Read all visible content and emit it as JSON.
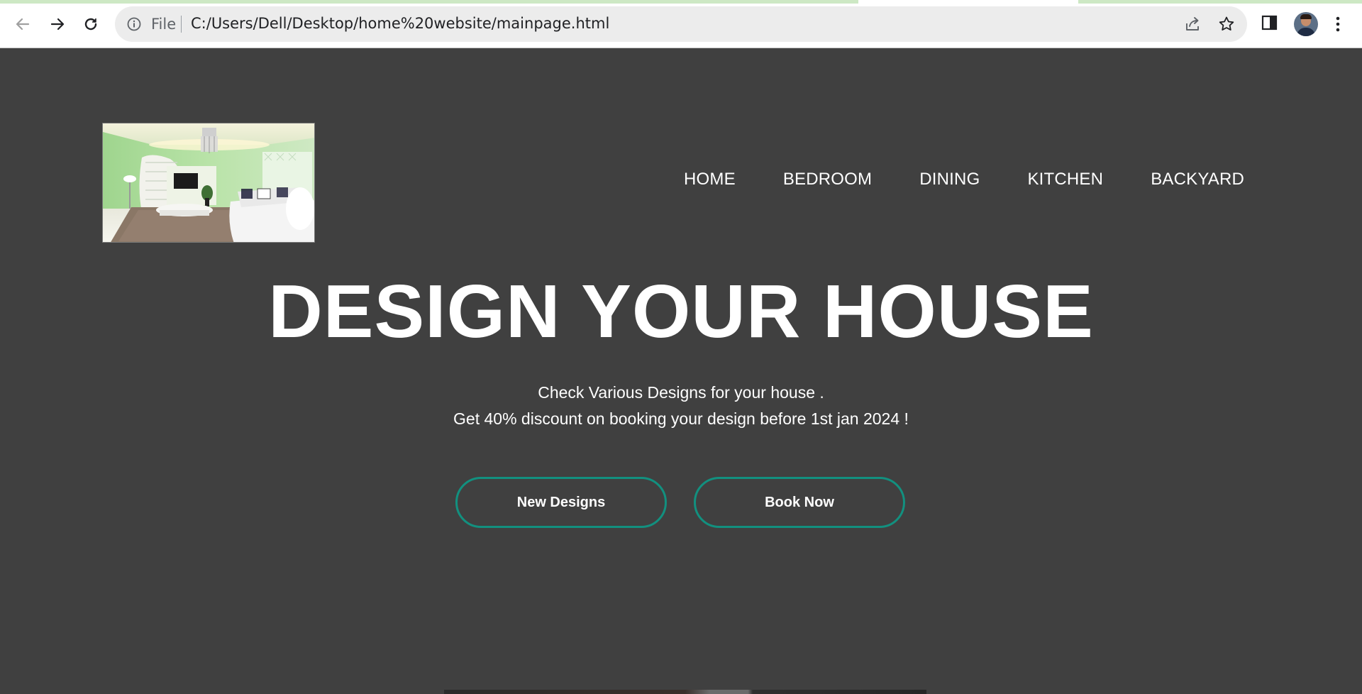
{
  "browser": {
    "scheme_label": "File",
    "url": "C:/Users/Dell/Desktop/home%20website/mainpage.html"
  },
  "site": {
    "nav": [
      {
        "label": "HOME"
      },
      {
        "label": "BEDROOM"
      },
      {
        "label": "DINING"
      },
      {
        "label": "KITCHEN"
      },
      {
        "label": "BACKYARD"
      }
    ],
    "hero": {
      "title": "DESIGN YOUR HOUSE",
      "line1": "Check Various Designs for your house .",
      "line2": "Get 40% discount on booking your design before 1st jan 2024 !"
    },
    "buttons": {
      "new_designs": "New Designs",
      "book_now": "Book Now"
    }
  },
  "colors": {
    "page_bg": "#404040",
    "button_border": "#12907f",
    "text": "#ffffff"
  }
}
